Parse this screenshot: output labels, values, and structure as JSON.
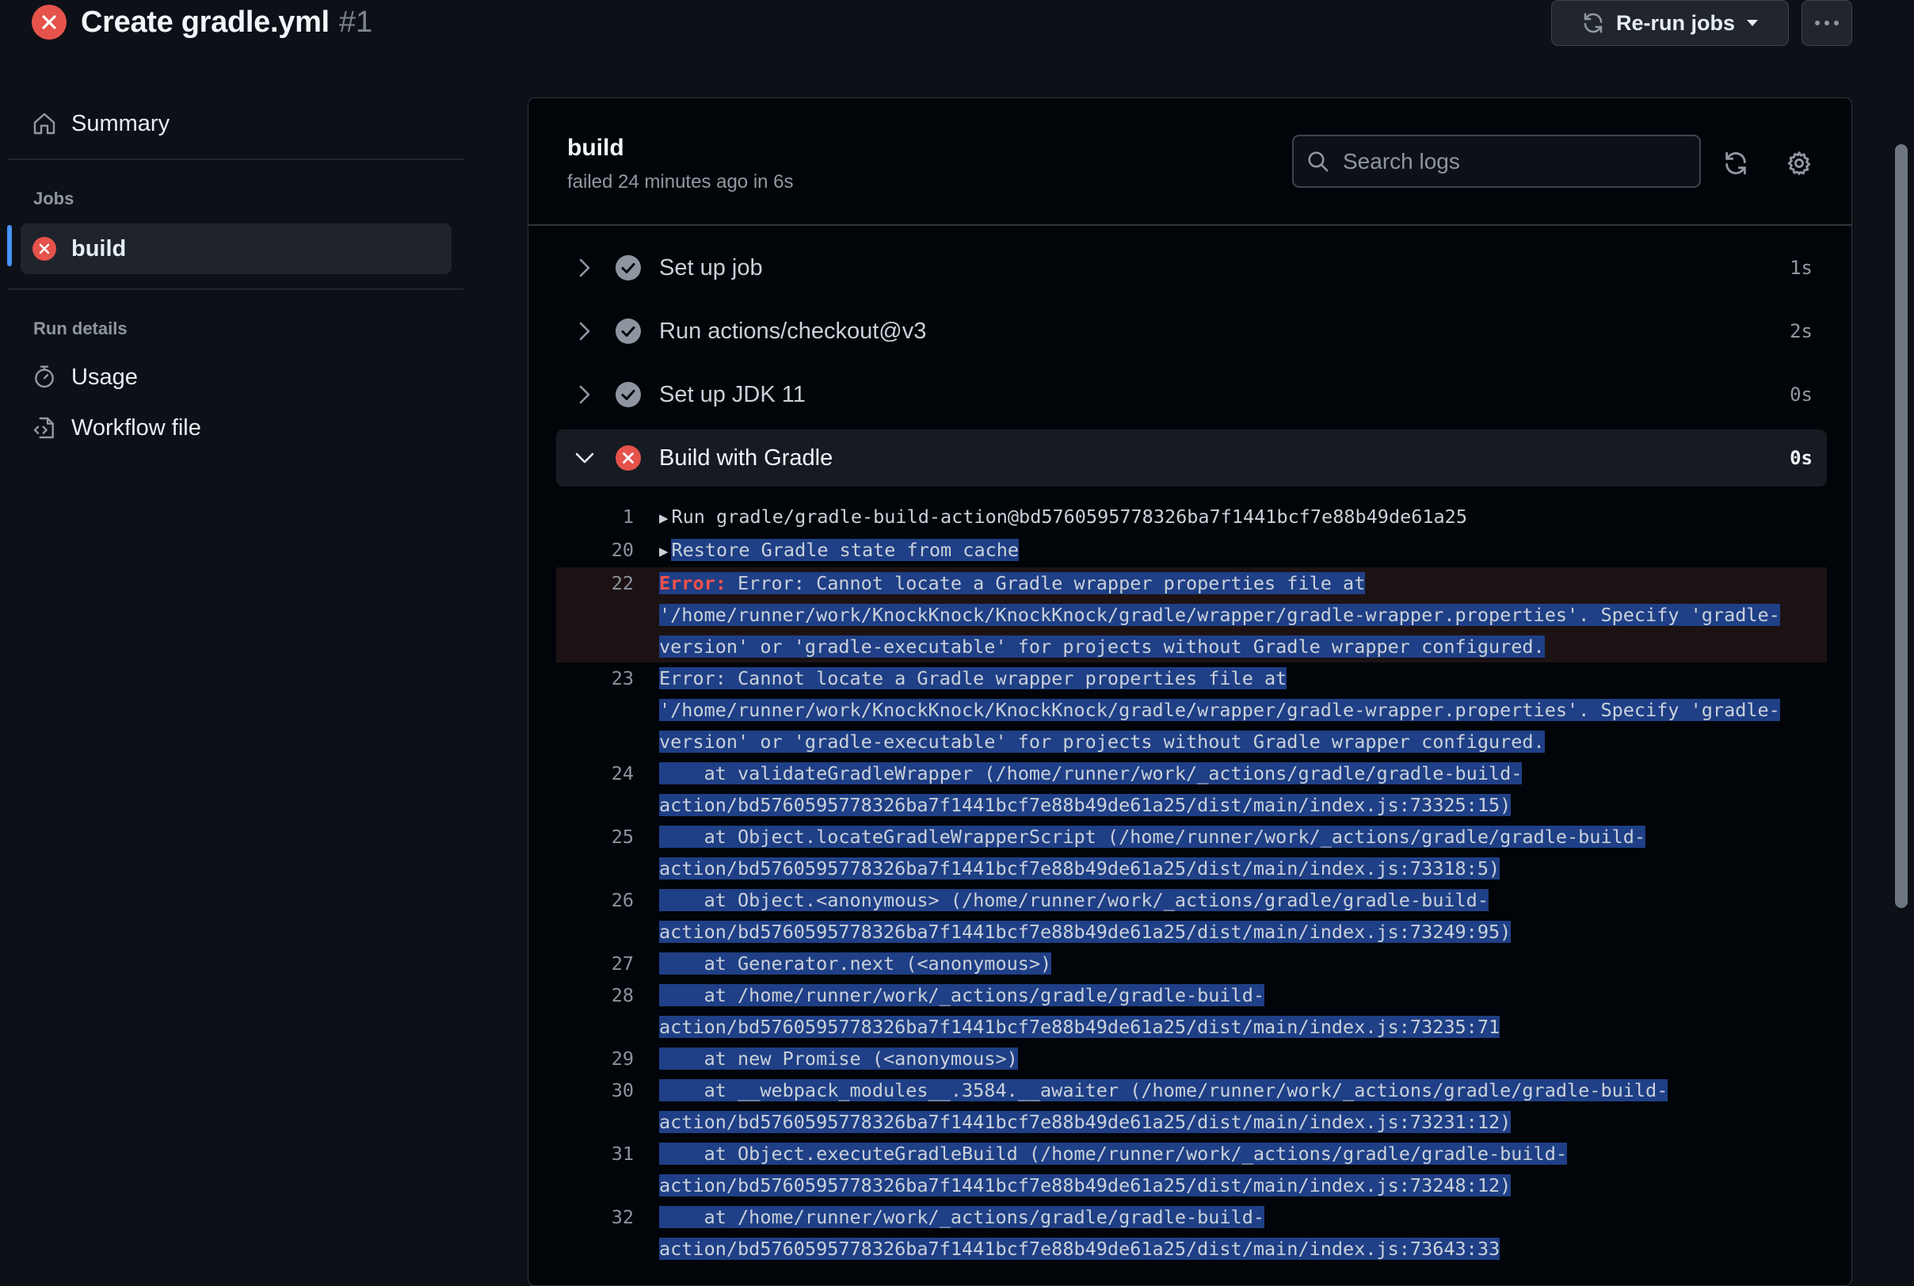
{
  "header": {
    "run_title": "Create gradle.yml",
    "run_number": "#1",
    "rerun_label": "Re-run jobs"
  },
  "sidebar": {
    "summary_label": "Summary",
    "jobs_heading": "Jobs",
    "job_label": "build",
    "run_details_heading": "Run details",
    "usage_label": "Usage",
    "workflow_file_label": "Workflow file"
  },
  "job": {
    "name": "build",
    "meta": "failed 24 minutes ago in 6s",
    "search_placeholder": "Search logs"
  },
  "steps": [
    {
      "label": "Set up job",
      "duration": "1s",
      "status": "success"
    },
    {
      "label": "Run actions/checkout@v3",
      "duration": "2s",
      "status": "success"
    },
    {
      "label": "Set up JDK 11",
      "duration": "0s",
      "status": "success"
    },
    {
      "label": "Build with Gradle",
      "duration": "0s",
      "status": "failure"
    }
  ],
  "log": {
    "line1": {
      "num": "1",
      "text": "Run gradle/gradle-build-action@bd5760595778326ba7f1441bcf7e88b49de61a25"
    },
    "line20": {
      "num": "20",
      "text": "Restore Gradle state from cache"
    },
    "line22": {
      "num": "22",
      "prefix": "Error:",
      "a": " Error: Cannot locate a Gradle wrapper properties file at ",
      "b": "'/home/runner/work/KnockKnock/KnockKnock/gradle/wrapper/gradle-wrapper.properties'. Specify 'gradle-",
      "c": "version' or 'gradle-executable' for projects without Gradle wrapper configured."
    },
    "line23": {
      "num": "23",
      "a": "Error: Cannot locate a Gradle wrapper properties file at ",
      "b": "'/home/runner/work/KnockKnock/KnockKnock/gradle/wrapper/gradle-wrapper.properties'. Specify 'gradle-",
      "c": "version' or 'gradle-executable' for projects without Gradle wrapper configured."
    },
    "line24": {
      "num": "24",
      "a": "    at validateGradleWrapper (/home/runner/work/_actions/gradle/gradle-build-",
      "b": "action/bd5760595778326ba7f1441bcf7e88b49de61a25/dist/main/index.js:73325:15)"
    },
    "line25": {
      "num": "25",
      "a": "    at Object.locateGradleWrapperScript (/home/runner/work/_actions/gradle/gradle-build-",
      "b": "action/bd5760595778326ba7f1441bcf7e88b49de61a25/dist/main/index.js:73318:5)"
    },
    "line26": {
      "num": "26",
      "a": "    at Object.<anonymous> (/home/runner/work/_actions/gradle/gradle-build-",
      "b": "action/bd5760595778326ba7f1441bcf7e88b49de61a25/dist/main/index.js:73249:95)"
    },
    "line27": {
      "num": "27",
      "a": "    at Generator.next (<anonymous>)"
    },
    "line28": {
      "num": "28",
      "a": "    at /home/runner/work/_actions/gradle/gradle-build-",
      "b": "action/bd5760595778326ba7f1441bcf7e88b49de61a25/dist/main/index.js:73235:71"
    },
    "line29": {
      "num": "29",
      "a": "    at new Promise (<anonymous>)"
    },
    "line30": {
      "num": "30",
      "a": "    at __webpack_modules__.3584.__awaiter (/home/runner/work/_actions/gradle/gradle-build-",
      "b": "action/bd5760595778326ba7f1441bcf7e88b49de61a25/dist/main/index.js:73231:12)"
    },
    "line31": {
      "num": "31",
      "a": "    at Object.executeGradleBuild (/home/runner/work/_actions/gradle/gradle-build-",
      "b": "action/bd5760595778326ba7f1441bcf7e88b49de61a25/dist/main/index.js:73248:12)"
    },
    "line32": {
      "num": "32",
      "a": "    at /home/runner/work/_actions/gradle/gradle-build-",
      "b": "action/bd5760595778326ba7f1441bcf7e88b49de61a25/dist/main/index.js:73643:33"
    }
  },
  "colors": {
    "background": "#0d1117",
    "failure": "#e5534b",
    "success": "#8d96a0",
    "selection": "#1f3f86",
    "accent": "#4493f8"
  },
  "icons": {
    "status_fail": "x-circle-fill-icon",
    "status_success": "check-circle-fill-icon",
    "home": "home-icon",
    "stopwatch": "stopwatch-icon",
    "workflow": "file-code-icon",
    "sync": "sync-icon",
    "gear": "gear-icon",
    "search": "search-icon",
    "kebab": "kebab-horizontal-icon"
  }
}
